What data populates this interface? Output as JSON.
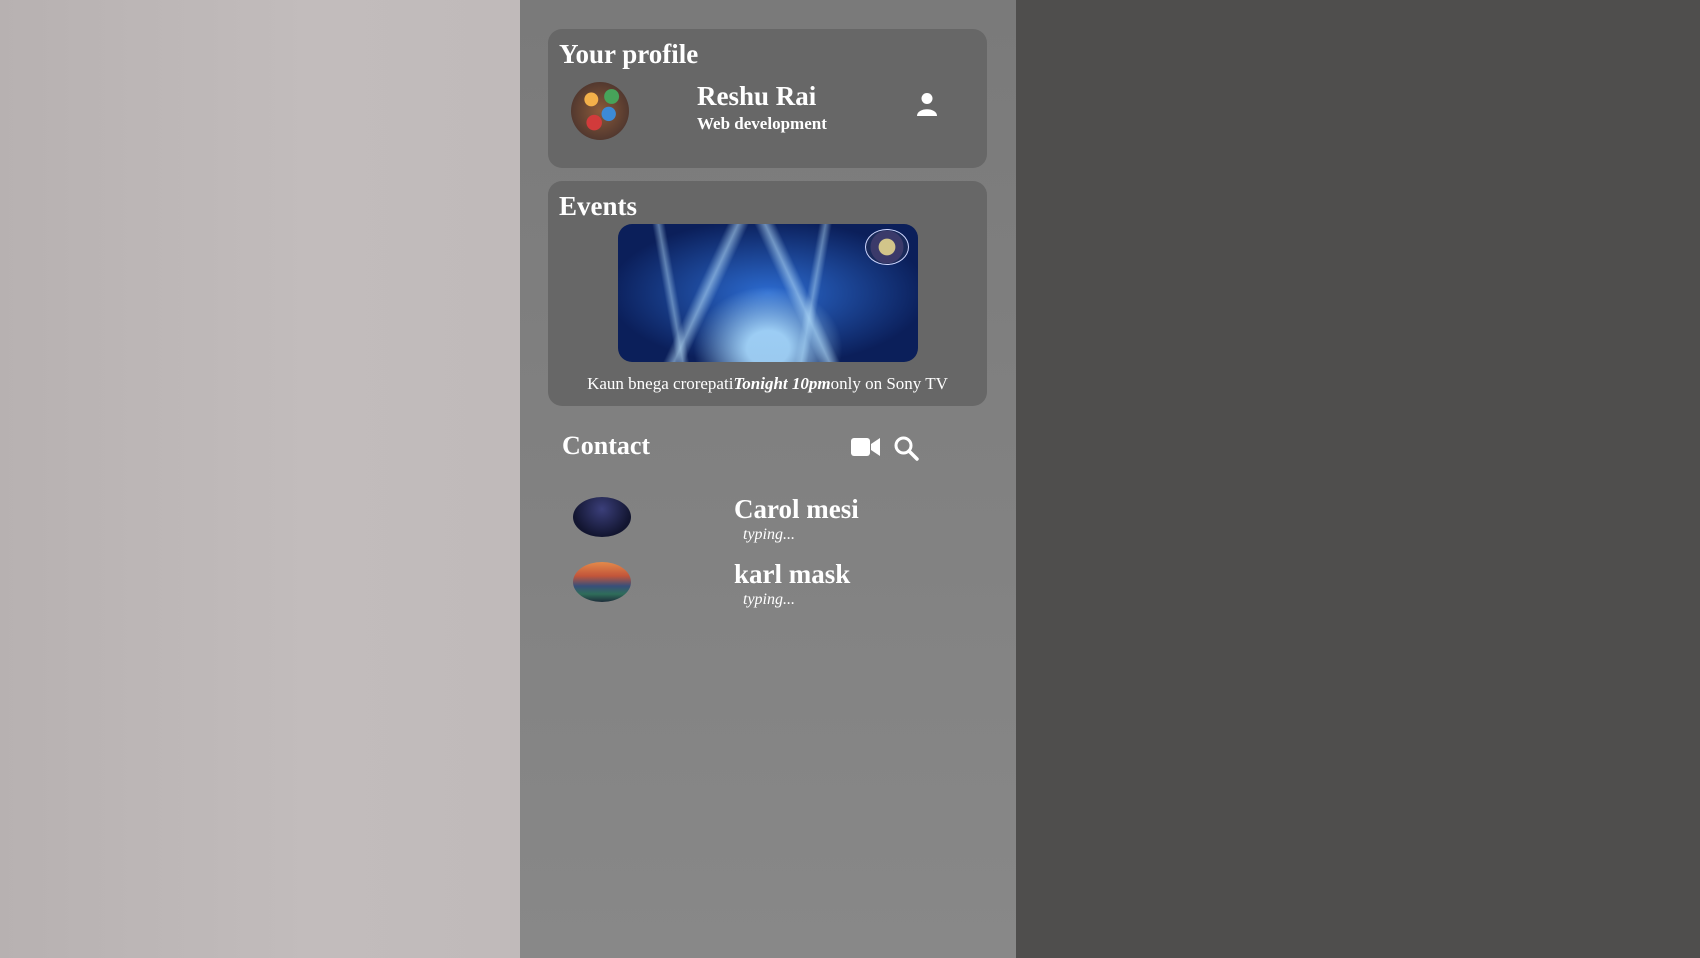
{
  "profile": {
    "title": "Your profile",
    "name": "Reshu Rai",
    "role": "Web development",
    "icon": "user-icon"
  },
  "events": {
    "title": "Events",
    "caption_prefix": "Kaun bnega crorepati",
    "caption_time": "Tonight 10pm",
    "caption_suffix": "only on Sony TV"
  },
  "contact": {
    "title": "Contact",
    "icons": [
      "video-icon",
      "search-icon"
    ],
    "items": [
      {
        "name": "Carol mesi",
        "status": "typing..."
      },
      {
        "name": "karl mask",
        "status": "typing..."
      }
    ]
  },
  "colors": {
    "left_pane": "#bdb7b7",
    "center_pane": "#808080",
    "right_pane": "#504f4e",
    "card": "#676767",
    "text": "#ffffff"
  }
}
